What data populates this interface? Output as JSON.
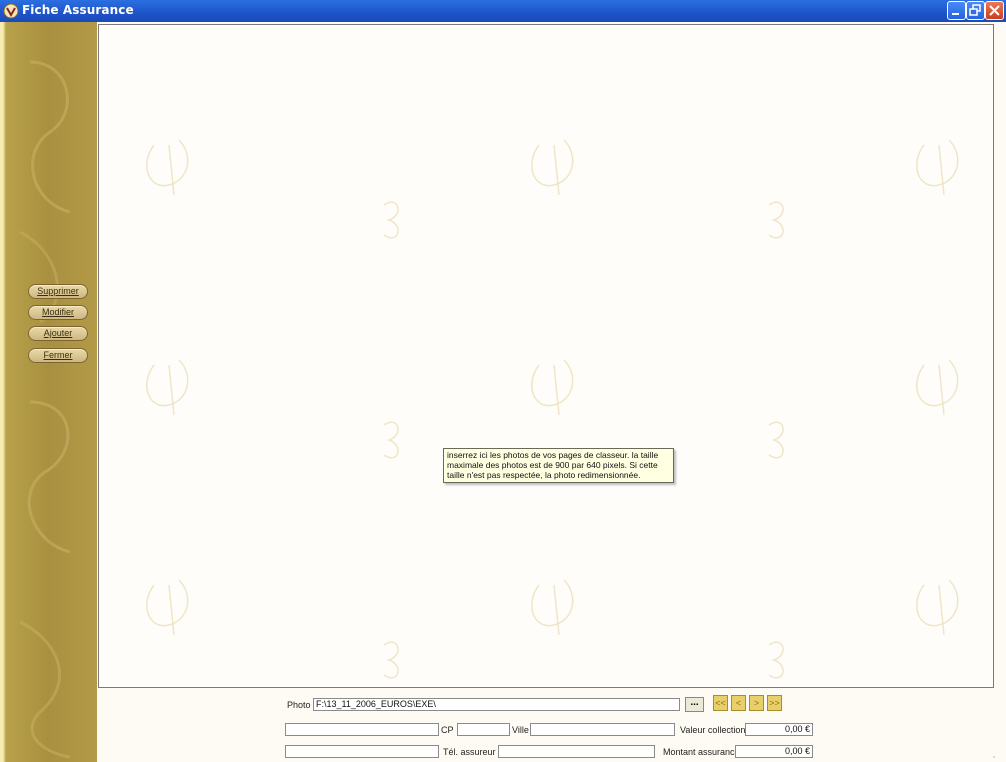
{
  "window": {
    "title": "Fiche Assurance"
  },
  "sidebar": {
    "buttons": [
      {
        "label": "Supprimer"
      },
      {
        "label": "Modifier"
      },
      {
        "label": "Ajouter"
      },
      {
        "label": "Fermer"
      }
    ]
  },
  "tooltip": {
    "text": "inserrez ici les photos de vos pages de classeur. la taille maximale des photos est de 900 par 640 pixels. Si cette taille n'est pas respectée, la photo redimensionnée."
  },
  "form": {
    "photo_label": "Photo",
    "photo_path": "F:\\13_11_2006_EUROS\\EXE\\",
    "browse_label": "...",
    "nav": [
      "<<",
      "<",
      ">",
      ">>"
    ],
    "cp_label": "CP",
    "ville_label": "Ville",
    "tel_label": "Tél. assureur",
    "valeur_label": "Valeur collection",
    "valeur_value": "0,00 €",
    "montant_label": "Montant assurance",
    "montant_value": "0,00 €"
  },
  "colors": {
    "titlebar": "#1d54c9",
    "sidebar": "#a89040",
    "nav_button": "#e7d06a"
  }
}
